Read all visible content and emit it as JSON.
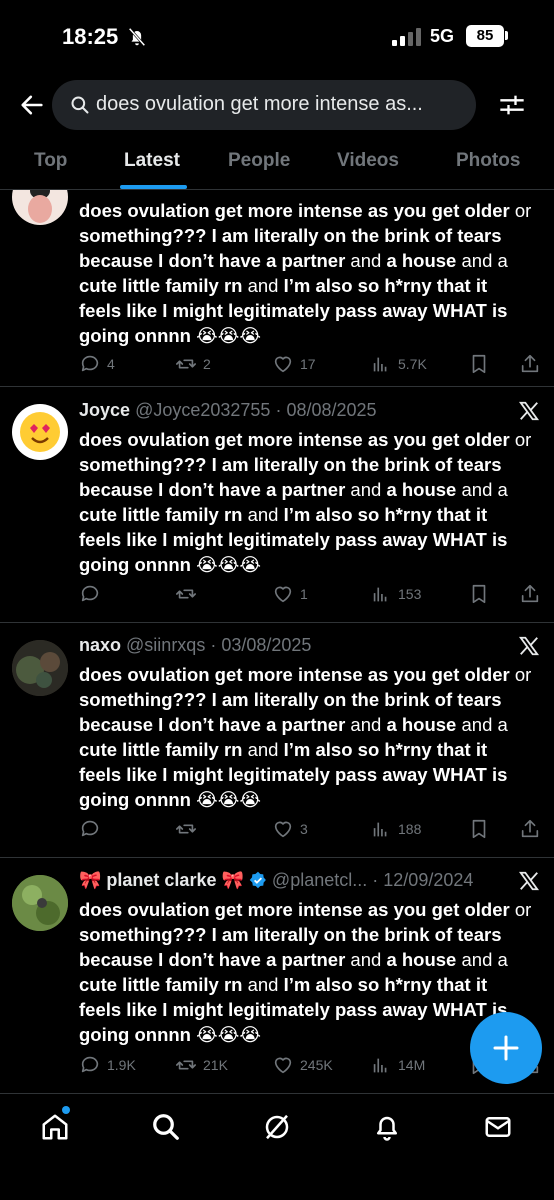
{
  "status_bar": {
    "time": "18:25",
    "network": "5G",
    "battery": "85"
  },
  "search": {
    "query": "does ovulation get more intense as..."
  },
  "tabs": [
    {
      "label": "Top"
    },
    {
      "label": "Latest"
    },
    {
      "label": "People"
    },
    {
      "label": "Videos"
    },
    {
      "label": "Photos"
    }
  ],
  "tweets": [
    {
      "name": "",
      "handle": "",
      "date": "",
      "body": [
        [
          "does ovulation get more intense as you get older",
          " or"
        ],
        [
          "something??? I am literally on the brink of tears",
          ""
        ],
        [
          "because I don’t have a partner",
          " and ",
          "a house",
          " and a"
        ],
        [
          "cute little family rn",
          " and ",
          "I’m also so h*rny that it",
          ""
        ],
        [
          "feels like I might legitimately pass away WHAT is",
          ""
        ],
        [
          "going onnnn 😭😭😭",
          ""
        ]
      ],
      "replies": "4",
      "reposts": "2",
      "likes": "17",
      "views": "5.7K"
    },
    {
      "name": "Joyce",
      "handle": "@Joyce2032755",
      "date": "08/08/2025",
      "body": [
        [
          "does ovulation get more intense as you get older",
          " or"
        ],
        [
          "something??? I am literally on the brink of tears",
          ""
        ],
        [
          "because I don’t have a partner",
          " and ",
          "a house",
          " and a"
        ],
        [
          "cute little family rn",
          " and ",
          "I’m also so h*rny that it",
          ""
        ],
        [
          "feels like I might legitimately pass away WHAT is",
          ""
        ],
        [
          "going onnnn 😭😭😭",
          ""
        ]
      ],
      "replies": "",
      "reposts": "",
      "likes": "1",
      "views": "153"
    },
    {
      "name": "naxo",
      "handle": "@siinrxqs",
      "date": "03/08/2025",
      "body": [
        [
          "does ovulation get more intense as you get older",
          " or"
        ],
        [
          "something??? I am literally on the brink of tears",
          ""
        ],
        [
          "because I don’t have a partner",
          " and ",
          "a house",
          " and a"
        ],
        [
          "cute little family rn",
          " and ",
          "I’m also so h*rny that it",
          ""
        ],
        [
          "feels like I might legitimately pass away WHAT is",
          ""
        ],
        [
          "going onnnn 😭😭😭",
          ""
        ]
      ],
      "replies": "",
      "reposts": "",
      "likes": "3",
      "views": "188"
    },
    {
      "name": "🎀 planet clarke 🎀",
      "handle": "@planetcl...",
      "date": "12/09/2024",
      "body": [
        [
          "does ovulation get more intense as you get older",
          " or"
        ],
        [
          "something??? I am literally on the brink of tears",
          ""
        ],
        [
          "because I don’t have a partner",
          " and ",
          "a house",
          " and a"
        ],
        [
          "cute little family rn",
          " and ",
          "I’m also so h*rny that it",
          ""
        ],
        [
          "feels like I might legitimately pass away WHAT is",
          ""
        ],
        [
          "going onnnn 😭😭😭",
          ""
        ]
      ],
      "replies": "1.9K",
      "reposts": "21K",
      "likes": "245K",
      "views": "14M"
    }
  ],
  "colors": {
    "accent": "#1d9bf0",
    "muted": "#71767b",
    "divider": "#2f3336"
  }
}
